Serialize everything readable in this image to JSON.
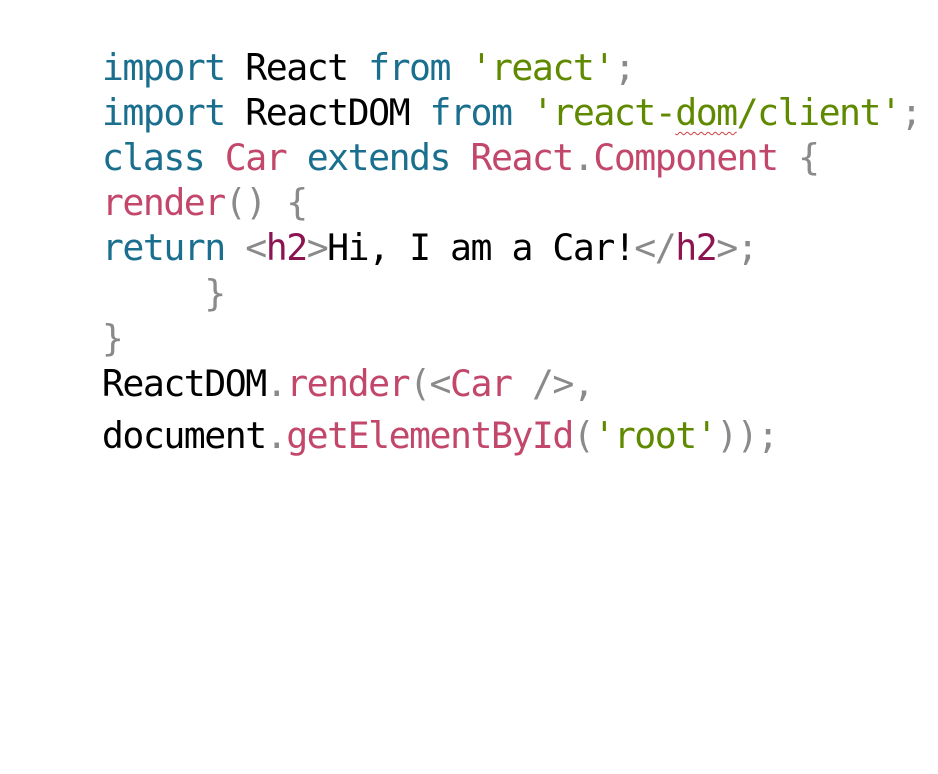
{
  "code_lines": [
    {
      "tokens": [
        {
          "type": "kw",
          "text": "import"
        },
        {
          "type": "txt",
          "text": " React "
        },
        {
          "type": "kw",
          "text": "from"
        },
        {
          "type": "txt",
          "text": " "
        },
        {
          "type": "str",
          "text": "'react'"
        },
        {
          "type": "gr",
          "text": ";"
        }
      ]
    },
    {
      "tokens": [
        {
          "type": "kw",
          "text": "import"
        },
        {
          "type": "txt",
          "text": " ReactDOM "
        },
        {
          "type": "kw",
          "text": "from"
        },
        {
          "type": "txt",
          "text": " "
        },
        {
          "type": "str",
          "text": "'react-"
        },
        {
          "type": "str-squiggle",
          "text": "dom"
        },
        {
          "type": "str",
          "text": "/client'"
        },
        {
          "type": "gr",
          "text": ";"
        }
      ]
    },
    {
      "tokens": [
        {
          "type": "kw",
          "text": "class"
        },
        {
          "type": "txt",
          "text": " "
        },
        {
          "type": "red",
          "text": "Car"
        },
        {
          "type": "txt",
          "text": " "
        },
        {
          "type": "kw",
          "text": "extends"
        },
        {
          "type": "txt",
          "text": " "
        },
        {
          "type": "red",
          "text": "React"
        },
        {
          "type": "gr",
          "text": "."
        },
        {
          "type": "red",
          "text": "Component"
        },
        {
          "type": "txt",
          "text": " "
        },
        {
          "type": "gr",
          "text": "{"
        }
      ]
    },
    {
      "tokens": [
        {
          "type": "red",
          "text": "render"
        },
        {
          "type": "gr",
          "text": "() {"
        }
      ]
    },
    {
      "tokens": [
        {
          "type": "kw",
          "text": "return"
        },
        {
          "type": "txt",
          "text": " "
        },
        {
          "type": "gr",
          "text": "<"
        },
        {
          "type": "tag",
          "text": "h2"
        },
        {
          "type": "gr",
          "text": ">"
        },
        {
          "type": "txt",
          "text": "Hi, I am a Car!"
        },
        {
          "type": "gr",
          "text": "</"
        },
        {
          "type": "tag",
          "text": "h2"
        },
        {
          "type": "gr",
          "text": ">;"
        }
      ]
    },
    {
      "tokens": [
        {
          "type": "txt",
          "text": "     "
        },
        {
          "type": "gr",
          "text": "}"
        }
      ]
    },
    {
      "tokens": [
        {
          "type": "gr",
          "text": "}"
        }
      ]
    },
    {
      "tokens": [
        {
          "type": "txt",
          "text": "ReactDOM"
        },
        {
          "type": "gr",
          "text": "."
        },
        {
          "type": "red",
          "text": "render"
        },
        {
          "type": "gr",
          "text": "(<"
        },
        {
          "type": "red",
          "text": "Car"
        },
        {
          "type": "txt",
          "text": " "
        },
        {
          "type": "gr",
          "text": "/>,"
        }
      ]
    },
    {
      "tokens": [
        {
          "type": "txt",
          "text": "document"
        },
        {
          "type": "gr",
          "text": "."
        },
        {
          "type": "red",
          "text": "getElementById"
        },
        {
          "type": "gr",
          "text": "("
        },
        {
          "type": "str",
          "text": "'root'"
        },
        {
          "type": "gr",
          "text": "));"
        }
      ]
    }
  ],
  "colors": {
    "keyword": "#1a6e8e",
    "string": "#5f8a00",
    "identifier": "#c2476b",
    "punctuation": "#8a8a8a",
    "tag": "#8b1451",
    "text": "#000000"
  }
}
